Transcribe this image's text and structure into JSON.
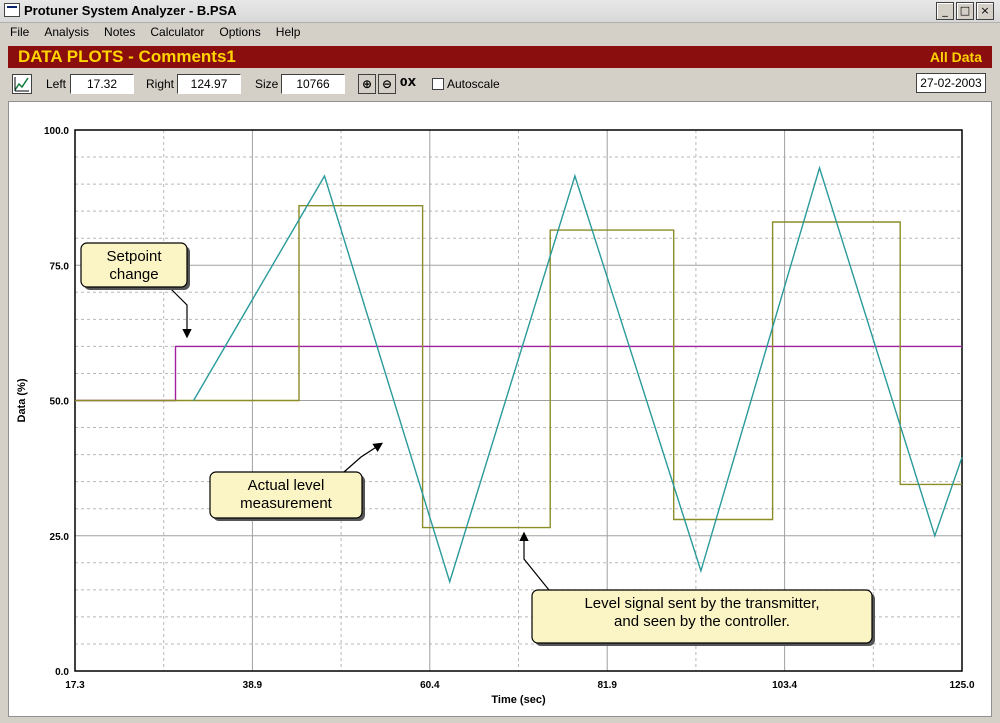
{
  "window": {
    "title": "Protuner System Analyzer - B.PSA",
    "minimize": "_",
    "maximize": "□",
    "close": "×"
  },
  "menu": [
    "File",
    "Analysis",
    "Notes",
    "Calculator",
    "Options",
    "Help"
  ],
  "banner": {
    "title": "DATA PLOTS - Comments1",
    "right": "All Data"
  },
  "toolbar": {
    "left_label": "Left",
    "left_value": "17.32",
    "right_label": "Right",
    "right_value": "124.97",
    "size_label": "Size",
    "size_value": "10766",
    "zoom_in": "⊕",
    "zoom_out": "⊖",
    "reset": "0X",
    "autoscale_label": "Autoscale",
    "date": "27-02-2003"
  },
  "icons": {
    "plot": "line-chart-icon",
    "zoom_in": "zoom-in-icon",
    "zoom_out": "zoom-out-icon"
  },
  "chart_data": {
    "type": "line",
    "xlabel": "Time (sec)",
    "ylabel": "Data (%)",
    "xlim": [
      17.3,
      125.0
    ],
    "ylim": [
      0,
      100
    ],
    "x_ticks": [
      "17.3",
      "38.9",
      "60.4",
      "81.9",
      "103.4",
      "125.0"
    ],
    "y_ticks": [
      "0.0",
      "25.0",
      "50.0",
      "75.0",
      "100.0"
    ],
    "grid": true,
    "series": [
      {
        "color": "#a020a0",
        "x": [
          17.3,
          29.5,
          29.5,
          125.0
        ],
        "y": [
          50,
          50,
          60,
          60
        ]
      },
      {
        "color": "#8c8c28",
        "x": [
          17.3,
          44.5,
          44.5,
          59.5,
          59.5,
          75.0,
          75.0,
          90.0,
          90.0,
          102.0,
          102.0,
          117.5,
          117.5,
          125.0
        ],
        "y": [
          50,
          50,
          86,
          86,
          26.5,
          26.5,
          81.5,
          81.5,
          28,
          28,
          83,
          83,
          34.5,
          34.5
        ]
      },
      {
        "color": "#2a9a9a",
        "x": [
          31.7,
          47.6,
          62.8,
          78.0,
          93.3,
          107.7,
          121.7,
          125.0
        ],
        "y": [
          50,
          91.5,
          16.5,
          91.5,
          18.5,
          93,
          25,
          39.5
        ]
      }
    ],
    "annotations": [
      {
        "text": [
          "Setpoint",
          "change"
        ]
      },
      {
        "text": [
          "Actual level",
          "measurement"
        ]
      },
      {
        "text": [
          "Level signal sent by the transmitter,",
          "and seen by the controller."
        ]
      }
    ]
  }
}
